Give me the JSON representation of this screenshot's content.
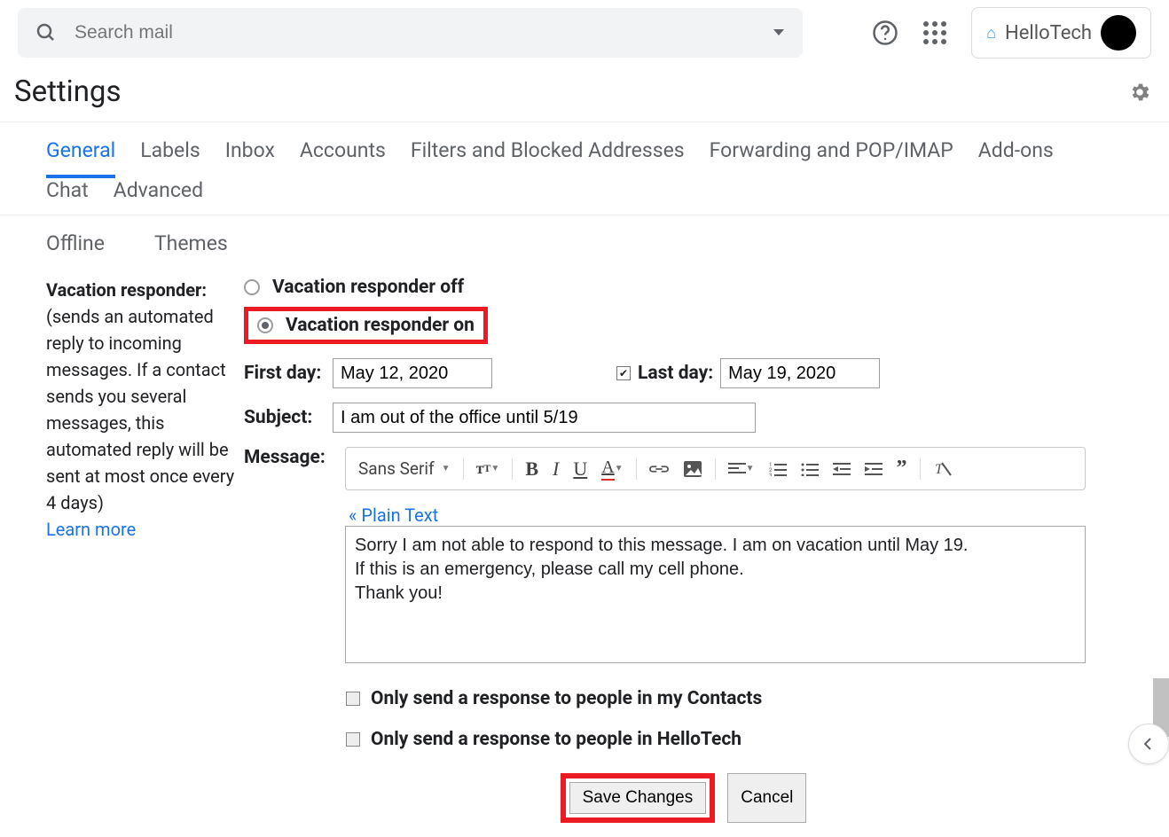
{
  "search": {
    "placeholder": "Search mail"
  },
  "brand": {
    "name": "HelloTech"
  },
  "page": {
    "title": "Settings"
  },
  "tabs": [
    "General",
    "Labels",
    "Inbox",
    "Accounts",
    "Filters and Blocked Addresses",
    "Forwarding and POP/IMAP",
    "Add-ons",
    "Chat",
    "Advanced"
  ],
  "tabs2": [
    "Offline",
    "Themes"
  ],
  "section": {
    "label": "Vacation responder:",
    "desc": "(sends an automated reply to incoming messages. If a contact sends you several messages, this automated reply will be sent at most once every 4 days)",
    "learn_more": "Learn more"
  },
  "vacation": {
    "off_label": "Vacation responder off",
    "on_label": "Vacation responder on",
    "first_day_label": "First day:",
    "first_day": "May 12, 2020",
    "last_day_label": "Last day:",
    "last_day": "May 19, 2020",
    "subject_label": "Subject:",
    "subject": "I am out of the office until 5/19",
    "message_label": "Message:",
    "plain_text": "« Plain Text",
    "message": "Sorry I am not able to respond to this message. I am on vacation until May 19.\nIf this is an emergency, please call my cell phone.\nThank you!",
    "contacts_only": "Only send a response to people in my Contacts",
    "domain_only": "Only send a response to people in HelloTech"
  },
  "toolbar": {
    "font": "Sans Serif"
  },
  "buttons": {
    "save": "Save Changes",
    "cancel": "Cancel"
  }
}
